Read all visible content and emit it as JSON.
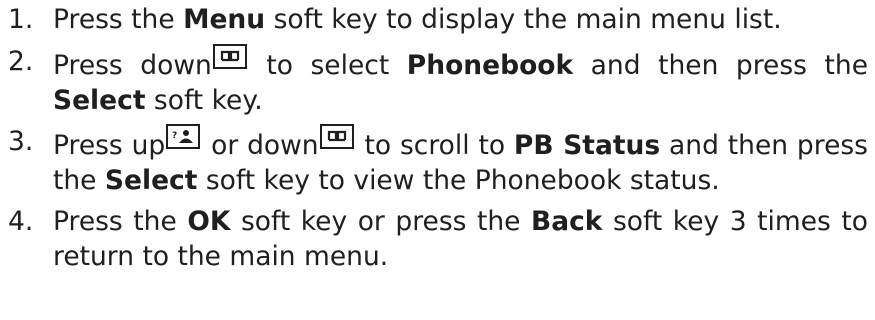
{
  "steps": [
    {
      "number": "1.",
      "parts": [
        "Press the ",
        "Menu",
        " soft key to display the main menu list."
      ]
    },
    {
      "number": "2.",
      "parts": [
        "Press down",
        " to select ",
        "Phonebook",
        " and then press the ",
        "Select",
        " soft key."
      ]
    },
    {
      "number": "3.",
      "parts": [
        "Press up",
        " or down",
        " to scroll to ",
        "PB Status",
        " and then press the ",
        "Select",
        " soft key to view the Phonebook status."
      ]
    },
    {
      "number": "4.",
      "parts": [
        "Press the ",
        "OK",
        " soft key or press the ",
        "Back",
        " soft key 3 times to return to the main menu."
      ]
    }
  ],
  "icons": {
    "down_key": "phonebook-down-key-icon",
    "up_key": "contact-up-key-icon"
  },
  "colors": {
    "text": "#1f1f1f",
    "background": "#ffffff"
  }
}
